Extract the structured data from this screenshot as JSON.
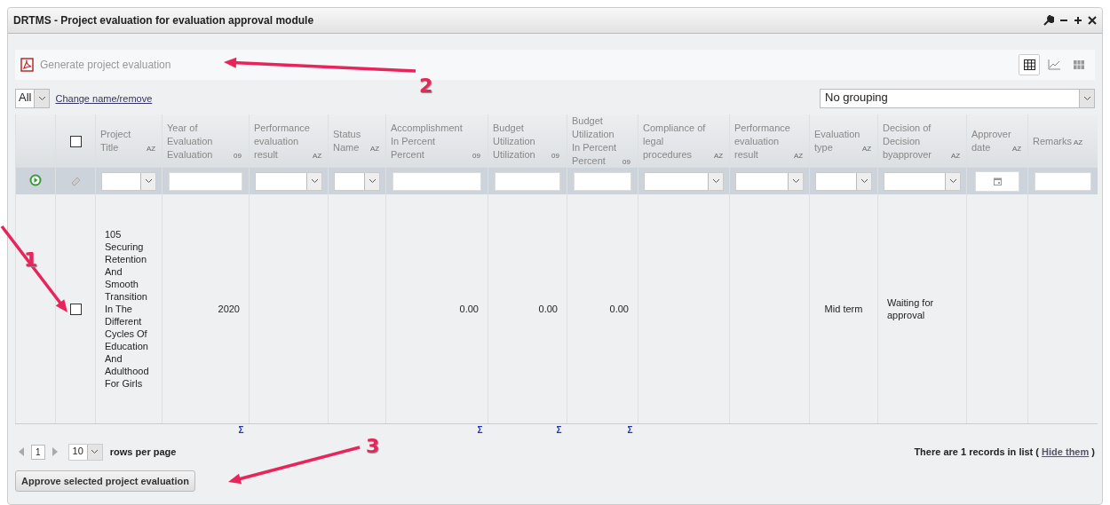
{
  "window": {
    "title": "DRTMS - Project evaluation for evaluation approval module"
  },
  "toolbar": {
    "generate_button": "Generate project evaluation",
    "views": [
      {
        "kind": "grid",
        "selected": true
      },
      {
        "kind": "chart",
        "selected": false
      },
      {
        "kind": "pivot",
        "selected": false
      }
    ]
  },
  "filter_bar": {
    "view_select": "All",
    "rename_link": "Change name/remove",
    "grouping_select": "No grouping"
  },
  "table": {
    "header_checkbox": {
      "checked": false
    },
    "columns": [
      {
        "label": "Project Title",
        "sort_icon": "AZ",
        "kind": "text",
        "filter": {
          "kind": "select"
        }
      },
      {
        "label": "Year of Evaluation Evaluation",
        "sort_icon": "09",
        "kind": "number",
        "filter": {
          "kind": "text"
        },
        "total": "Σ"
      },
      {
        "label": "Performance evaluation result",
        "sort_icon": "AZ",
        "kind": "text",
        "filter": {
          "kind": "select"
        }
      },
      {
        "label": "Status Name",
        "sort_icon": "AZ",
        "kind": "text",
        "filter": {
          "kind": "select"
        }
      },
      {
        "label": "Accomplishment In Percent Percent",
        "sort_icon": "09",
        "kind": "number",
        "filter": {
          "kind": "text"
        },
        "total": "Σ"
      },
      {
        "label": "Budget Utilization Utilization",
        "sort_icon": "09",
        "kind": "number",
        "filter": {
          "kind": "text"
        },
        "total": "Σ"
      },
      {
        "label": "Budget Utilization In Percent Percent",
        "sort_icon": "09",
        "kind": "number",
        "filter": {
          "kind": "text"
        },
        "total": "Σ"
      },
      {
        "label": "Compliance of legal procedures",
        "sort_icon": "AZ",
        "kind": "text",
        "filter": {
          "kind": "select"
        }
      },
      {
        "label": "Performance evaluation result",
        "sort_icon": "AZ",
        "kind": "text",
        "filter": {
          "kind": "select"
        }
      },
      {
        "label": "Evaluation type",
        "sort_icon": "AZ",
        "kind": "centered",
        "filter": {
          "kind": "select"
        }
      },
      {
        "label": "Decision of Decision byapprover",
        "sort_icon": "AZ",
        "kind": "text",
        "filter": {
          "kind": "select"
        }
      },
      {
        "label": "Approver date",
        "sort_icon": "AZ",
        "kind": "text",
        "filter": {
          "kind": "date"
        }
      },
      {
        "label": "Remarks",
        "sort_icon": "AZ",
        "kind": "text",
        "filter": {
          "kind": "text"
        }
      }
    ],
    "rows": [
      {
        "checked": false,
        "cells": [
          "105 Securing Retention And Smooth Transition In The Different Cycles Of Education And Adulthood For Girls",
          "2020",
          null,
          null,
          "0.00",
          "0.00",
          "0.00",
          null,
          null,
          "Mid term",
          "Waiting for approval",
          null,
          null
        ]
      }
    ]
  },
  "pager": {
    "page": "1",
    "rows_per_page": "10",
    "rows_label": "rows per page"
  },
  "summary": {
    "text": "There are 1 records in list (",
    "link": "Hide them",
    "close": ")"
  },
  "approve_button": "Approve selected project evaluation",
  "annotations": [
    {
      "label": "1"
    },
    {
      "label": "2"
    },
    {
      "label": "3"
    }
  ]
}
